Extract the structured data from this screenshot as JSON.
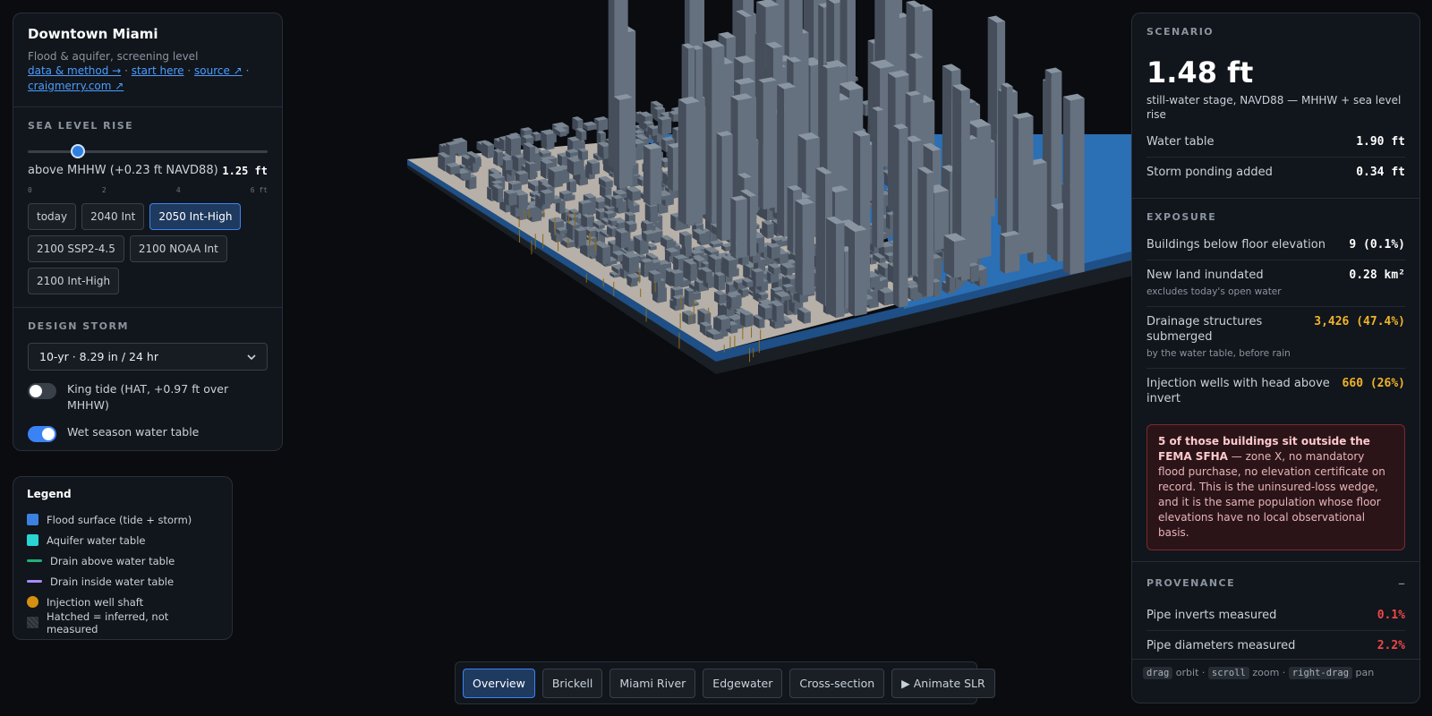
{
  "header": {
    "title": "Downtown Miami",
    "subtitle": "Flood & aquifer, screening level",
    "links": [
      "data & method →",
      "start here",
      "source ↗",
      "craigmerry.com ↗"
    ],
    "link_sep": "·"
  },
  "slr": {
    "heading": "SEA LEVEL RISE",
    "fraction": 0.21,
    "label": "above MHHW (+0.23 ft NAVD88)",
    "value": "1.25 ft",
    "ticks": [
      "0",
      "2",
      "4",
      "6 ft"
    ],
    "presets": [
      {
        "label": "today",
        "active": false
      },
      {
        "label": "2040 Int",
        "active": false
      },
      {
        "label": "2050 Int-High",
        "active": true
      },
      {
        "label": "2100 SSP2-4.5",
        "active": false
      },
      {
        "label": "2100 NOAA Int",
        "active": false
      },
      {
        "label": "2100 Int-High",
        "active": false
      }
    ]
  },
  "storm": {
    "heading": "DESIGN STORM",
    "selected": "10-yr · 8.29 in / 24 hr",
    "king_tide": {
      "label": "King tide (HAT, +0.97 ft over MHHW)",
      "on": false
    },
    "wet_season": {
      "label": "Wet season water table",
      "on": true
    }
  },
  "legend": {
    "title": "Legend",
    "items": [
      {
        "label": "Flood surface (tide + storm)",
        "shape": "square",
        "color": "#3b82e0"
      },
      {
        "label": "Aquifer water table",
        "shape": "square",
        "color": "#2ad4d4"
      },
      {
        "label": "Drain above water table",
        "shape": "line",
        "color": "#22b07a"
      },
      {
        "label": "Drain inside water table",
        "shape": "line",
        "color": "#a78bfa"
      },
      {
        "label": "Injection well shaft",
        "shape": "dot",
        "color": "#d4900f"
      },
      {
        "label": "Hatched = inferred, not measured",
        "shape": "square",
        "color": "#2a2f37"
      }
    ]
  },
  "scenario": {
    "heading": "SCENARIO",
    "stage": "1.48 ft",
    "stage_desc": "still-water stage, NAVD88 — MHHW + sea level rise",
    "rows": [
      {
        "label": "Water table",
        "value": "1.90 ft"
      },
      {
        "label": "Storm ponding added",
        "value": "0.34 ft"
      }
    ]
  },
  "exposure": {
    "heading": "EXPOSURE",
    "rows": [
      {
        "label": "Buildings below floor elevation",
        "note": "",
        "value": "9 (0.1%)",
        "tone": "normal"
      },
      {
        "label": "New land inundated",
        "note": "excludes today's open water",
        "value": "0.28 km²",
        "tone": "normal"
      },
      {
        "label": "Drainage structures submerged",
        "note": "by the water table, before rain",
        "value": "3,426 (47.4%)",
        "tone": "warn"
      },
      {
        "label": "Injection wells with head above invert",
        "note": "",
        "value": "660 (26%)",
        "tone": "warn"
      }
    ],
    "alert_bold": "5 of those buildings sit outside the FEMA SFHA",
    "alert_text": " — zone X, no mandatory flood purchase, no elevation certificate on record. This is the uninsured-loss wedge, and it is the same population whose floor elevations have no local observational basis."
  },
  "provenance": {
    "heading": "PROVENANCE",
    "toggle": "–",
    "rows": [
      {
        "label": "Pipe inverts measured",
        "value": "0.1%",
        "tone": "bad"
      },
      {
        "label": "Pipe diameters measured",
        "value": "2.2%",
        "tone": "bad"
      }
    ]
  },
  "hints": {
    "drag": "drag",
    "drag_action": "orbit",
    "scroll": "scroll",
    "scroll_action": "zoom",
    "rdrag": "right-drag",
    "rdrag_action": "pan",
    "sep": "·"
  },
  "views": [
    {
      "label": "Overview",
      "active": true
    },
    {
      "label": "Brickell",
      "active": false
    },
    {
      "label": "Miami River",
      "active": false
    },
    {
      "label": "Edgewater",
      "active": false
    },
    {
      "label": "Cross-section",
      "active": false
    },
    {
      "label": "▶ Animate SLR",
      "active": false
    }
  ],
  "colors": {
    "accent": "#3b82f6",
    "water": "#2e6fb0",
    "land": "#b9b3ac",
    "buildings": "#5b6573",
    "warn": "#f0b429",
    "bad": "#f04848"
  }
}
